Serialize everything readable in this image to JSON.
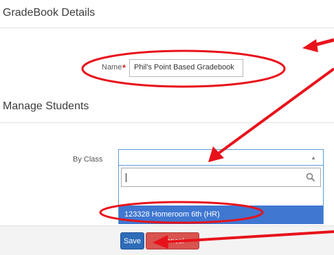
{
  "sections": {
    "gradebook_title": "GradeBook Details",
    "manage_title": "Manage Students"
  },
  "name_field": {
    "label": "Name",
    "required_marker": "*",
    "value": "Phil's Point Based Gradebook"
  },
  "by_class": {
    "label": "By Class",
    "search_value": "",
    "highlighted_option": "123328 Homeroom 6th (HR)"
  },
  "buttons": {
    "save": "Save",
    "cancel": "Cancel"
  },
  "annotation_color": "#e8121b",
  "icons": [
    "search-icon",
    "chevron-up-icon",
    "arrow-annotation",
    "ellipse-annotation"
  ]
}
